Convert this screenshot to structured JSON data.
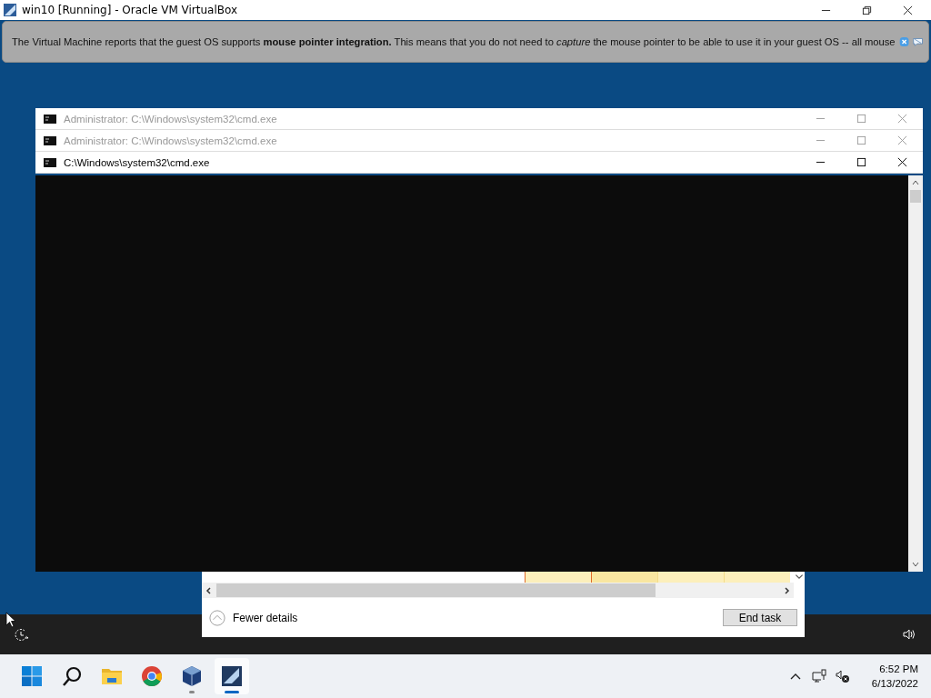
{
  "window": {
    "title": "win10 [Running] - Oracle VM VirtualBox"
  },
  "notification": {
    "text": "The Virtual Machine reports that the guest OS supports **mouse pointer integration.** This means that you do not need to *capture* the mouse pointer to be able to use it in your guest OS -- all mouse"
  },
  "guest_windows": [
    {
      "title": "Administrator: C:\\Windows\\system32\\cmd.exe",
      "active": false
    },
    {
      "title": "Administrator: C:\\Windows\\system32\\cmd.exe",
      "active": false
    },
    {
      "title": "C:\\Windows\\system32\\cmd.exe",
      "active": true
    }
  ],
  "task_manager": {
    "details_toggle": "Fewer details",
    "end_task": "End task"
  },
  "taskbar": {
    "apps": [
      {
        "kind": "start",
        "running": false,
        "active": false
      },
      {
        "kind": "search",
        "running": false,
        "active": false
      },
      {
        "kind": "explorer",
        "running": false,
        "active": false
      },
      {
        "kind": "chrome",
        "running": false,
        "active": false
      },
      {
        "kind": "virtualbox",
        "running": true,
        "active": false
      },
      {
        "kind": "vm",
        "running": true,
        "active": true
      }
    ],
    "time": "6:52 PM",
    "date": "6/13/2022"
  }
}
